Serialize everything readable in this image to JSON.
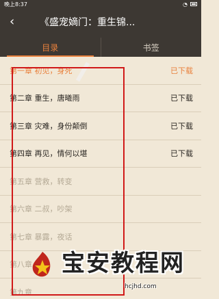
{
  "status_bar": {
    "time": "晚上8:37",
    "battery_icon": "battery-icon",
    "wifi_icon": "wifi-icon"
  },
  "header": {
    "back_icon": "‹",
    "title": "《盛宠嫡门：重生锦..."
  },
  "tabs": [
    {
      "label": "目录",
      "active": true
    },
    {
      "label": "书签",
      "active": false
    }
  ],
  "chapters": [
    {
      "title": "第一章 初见，身死",
      "status": "已下载",
      "state": "current"
    },
    {
      "title": "第二章 重生，唐曦雨",
      "status": "已下载",
      "state": "downloaded"
    },
    {
      "title": "第三章 灾难，身份颠倒",
      "status": "已下载",
      "state": "downloaded"
    },
    {
      "title": "第四章 再见，情何以堪",
      "status": "已下载",
      "state": "downloaded"
    },
    {
      "title": "第五章 营救，转变",
      "status": "",
      "state": "locked"
    },
    {
      "title": "第六章 二叔，吵架",
      "status": "",
      "state": "locked"
    },
    {
      "title": "第七章 暴露，夜话",
      "status": "",
      "state": "locked"
    },
    {
      "title": "第八章",
      "status": "",
      "state": "locked"
    },
    {
      "title": "第九章",
      "status": "",
      "state": "locked"
    }
  ],
  "watermark": {
    "brand": "宝安教程网",
    "url": "hcjhd.com"
  },
  "colors": {
    "accent": "#e9813d",
    "header_bg": "#3d3833",
    "page_bg": "#f1e8d7",
    "highlight_box": "#d01818"
  }
}
